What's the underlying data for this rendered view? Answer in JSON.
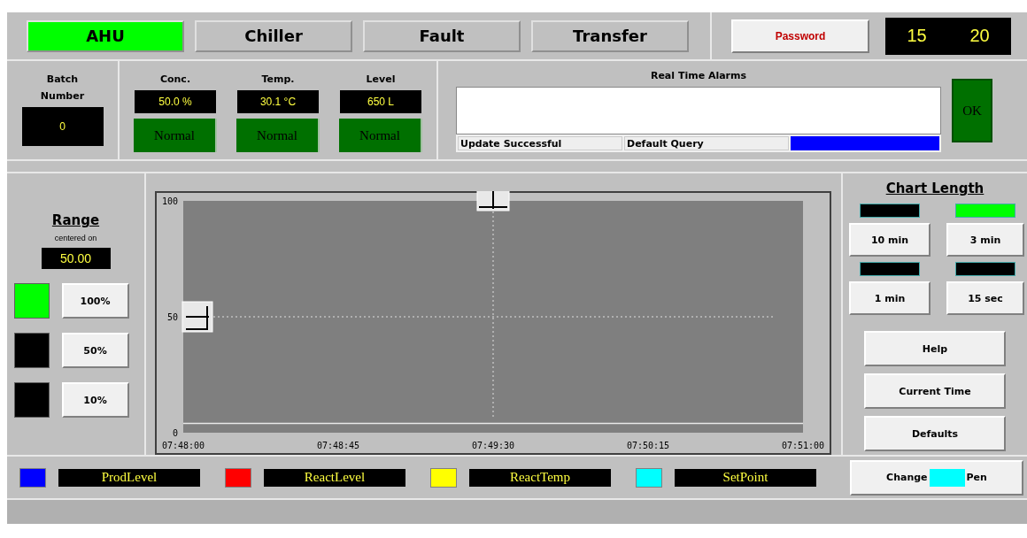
{
  "tabs": [
    {
      "label": "AHU",
      "selected": true
    },
    {
      "label": "Chiller",
      "selected": false
    },
    {
      "label": "Fault",
      "selected": false
    },
    {
      "label": "Transfer",
      "selected": false
    }
  ],
  "password_button": "Password",
  "clock": [
    "15",
    "20"
  ],
  "batch": {
    "label_1": "Batch",
    "label_2": "Number",
    "value": "0"
  },
  "measures": [
    {
      "label": "Conc.",
      "value": "50.0 %",
      "status": "Normal"
    },
    {
      "label": "Temp.",
      "value": "30.1 °C",
      "status": "Normal"
    },
    {
      "label": "Level",
      "value": "650 L",
      "status": "Normal"
    }
  ],
  "alarms": {
    "title": "Real Time Alarms",
    "status": "Update Successful",
    "query": "Default Query",
    "progress": {
      "level": 1
    },
    "ok_button": "OK"
  },
  "range": {
    "title": "Range",
    "subtitle": "centered on",
    "value": "50.00",
    "options": [
      {
        "label": "100%",
        "selected": true
      },
      {
        "label": "50%",
        "selected": false
      },
      {
        "label": "10%",
        "selected": false
      }
    ]
  },
  "chart": {
    "chart_data": {
      "type": "line",
      "ylim": [
        0,
        100
      ],
      "yticks": [
        0,
        50,
        100
      ],
      "categories": [
        "07:48:00",
        "07:48:45",
        "07:49:30",
        "07:50:15",
        "07:51:00"
      ],
      "series": [
        {
          "color": "#e8e8e8",
          "values": [
            4,
            4,
            4,
            4,
            4
          ]
        }
      ],
      "ref_lines": [
        {
          "axis": "y",
          "value": 50
        },
        {
          "axis": "x",
          "value": "07:49:30"
        }
      ]
    }
  },
  "chart_length": {
    "title": "Chart Length",
    "options": [
      {
        "label": "10 min",
        "selected": false
      },
      {
        "label": "3 min",
        "selected": true
      },
      {
        "label": "1 min",
        "selected": false
      },
      {
        "label": "15 sec",
        "selected": false
      }
    ],
    "buttons": [
      "Help",
      "Current Time",
      "Defaults"
    ]
  },
  "pens": [
    {
      "name": "ProdLevel",
      "color": "#0000ff"
    },
    {
      "name": "ReactLevel",
      "color": "#ff0000"
    },
    {
      "name": "ReactTemp",
      "color": "#ffff00"
    },
    {
      "name": "SetPoint",
      "color": "#00ffff"
    }
  ],
  "change_pen": {
    "label_1": "Change",
    "label_2": "Pen",
    "color": "#00ffff"
  }
}
